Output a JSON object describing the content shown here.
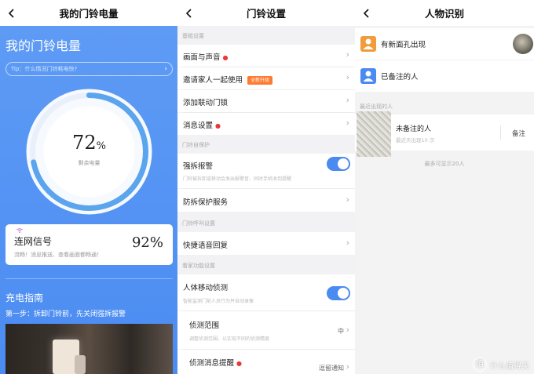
{
  "panel1": {
    "header_title": "我的门铃电量",
    "big_title": "我的门铃电量",
    "tip": "Tip：什么情况门铃耗电快?",
    "battery": {
      "value": "72",
      "unit": "%",
      "level": 0.72,
      "label": "剩余电量"
    },
    "wifi": {
      "title": "连网信号",
      "sub": "流畅！消息推送、查看画面都畅通！",
      "value": "92%"
    },
    "guide_title": "充电指南",
    "guide_step": "第一步：拆卸门铃前，先关闭强拆报警"
  },
  "panel2": {
    "header_title": "门铃设置",
    "sections": {
      "basic": "基础设置",
      "protect": "门铃自保护",
      "call": "门铃呼叫设置",
      "guard": "看家功能设置"
    },
    "rows": {
      "picture_sound": "画面与声音",
      "invite": "邀请家人一起使用",
      "invite_badge": "全新升级",
      "linked_lock": "添加联动门锁",
      "message_settings": "消息设置",
      "anti_tamper": "强拆报警",
      "anti_tamper_sub": "门铃被拆卸或移动会发出报警音，同时手机收到提醒",
      "protect_service": "防拆保护服务",
      "quick_reply": "快捷语音回复",
      "motion": "人体移动侦测",
      "motion_sub": "智能监测门前人员行为并自动录像",
      "range": "侦测范围",
      "range_sub": "调整侦测范围，以实现不同的侦测精度",
      "range_value": "中",
      "msg_alert": "侦测消息提醒",
      "msg_alert_value": "逗留通知"
    }
  },
  "panel3": {
    "header_title": "人物识别",
    "new_face": "有新面孔出现",
    "noted": "已备注的人",
    "recent_section": "最近出现的人",
    "person_name": "未备注的人",
    "person_sub": "最近天出现10 次",
    "note_action": "备注",
    "max_note": "最多可显示20人"
  },
  "watermark": "什么值得买",
  "watermark_glyph": "值",
  "colors": {
    "accent": "#4a8af1",
    "red_dot": "#e63a3a",
    "badge": "#ff7a2f",
    "new_face_icon": "#f29b3a",
    "noted_icon": "#4a8af1"
  },
  "icons": [
    "back-chevron-icon",
    "wifi-icon",
    "chevron-right-icon",
    "person-icon"
  ]
}
